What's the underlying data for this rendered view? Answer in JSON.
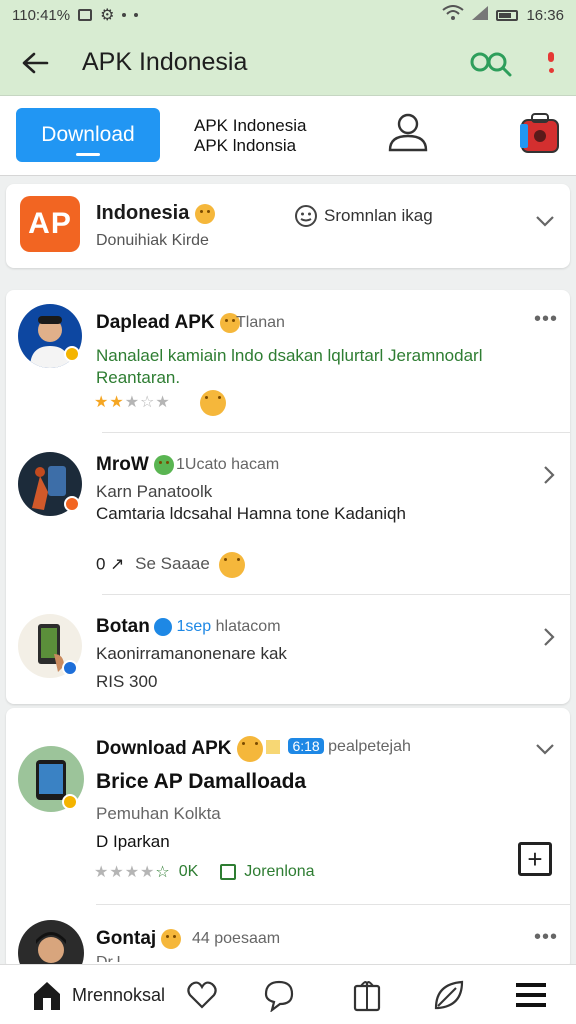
{
  "status_bar": {
    "left_text": "110:41%",
    "time": "16:36"
  },
  "app_bar": {
    "title": "APK Indonesia"
  },
  "top_strip": {
    "download_label": "Download",
    "name_line1": "APK Indonesia",
    "name_line2": "APK lndonsia"
  },
  "header_card": {
    "logo_text": "AP",
    "title": "Indonesia",
    "subtitle": "Donuihiak Kirde",
    "middle_text": "Sromnlan ikag"
  },
  "feed": [
    {
      "name": "Daplead APK",
      "meta": "Tlanan",
      "text_line1": "Nanalael kamiain lndo dsakan lqlurtarl Jeramnodarl",
      "text_line2": "Reantaran."
    },
    {
      "name": "MroW",
      "meta": "1Ucato hacam",
      "line1": "Karn Panatoolk",
      "line2": "Camtaria ldcsahal Hamna tone Kadaniqh",
      "footer_num": "0 ↗",
      "footer_label": "Se Saaae"
    },
    {
      "name": "Botan",
      "meta_blue": "1sep",
      "meta": "hlatacom",
      "line1": "Kaonirramanonenare kak",
      "line2": "RIS 300"
    }
  ],
  "post_card": {
    "name": "Download APK",
    "tag": "6:18",
    "meta": "pealpetejah",
    "headline": "Brice AP Damalloada",
    "sub": "Pemuhan Kolkta",
    "line": "D  Iparkan",
    "ok_label": "0K",
    "green_label": "Jorenlona"
  },
  "next_post": {
    "name": "Gontaj",
    "meta": "44 poesaam",
    "cut_text": "Dr.L"
  },
  "bottom_nav": {
    "item1_label": "Mrennoksal"
  },
  "colors": {
    "accent_blue": "#2196f3",
    "appbar_green": "#d8ecd2",
    "brand_orange": "#f26522",
    "search_green": "#2e9e5b"
  },
  "icons": [
    "back-arrow-icon",
    "search-icon",
    "overflow-menu-icon",
    "user-icon",
    "bag-icon",
    "chevron-down-icon",
    "chevron-right-icon",
    "plus-icon",
    "home-icon",
    "heart-icon",
    "chat-icon",
    "gift-icon",
    "leaf-icon",
    "menu-icon"
  ]
}
